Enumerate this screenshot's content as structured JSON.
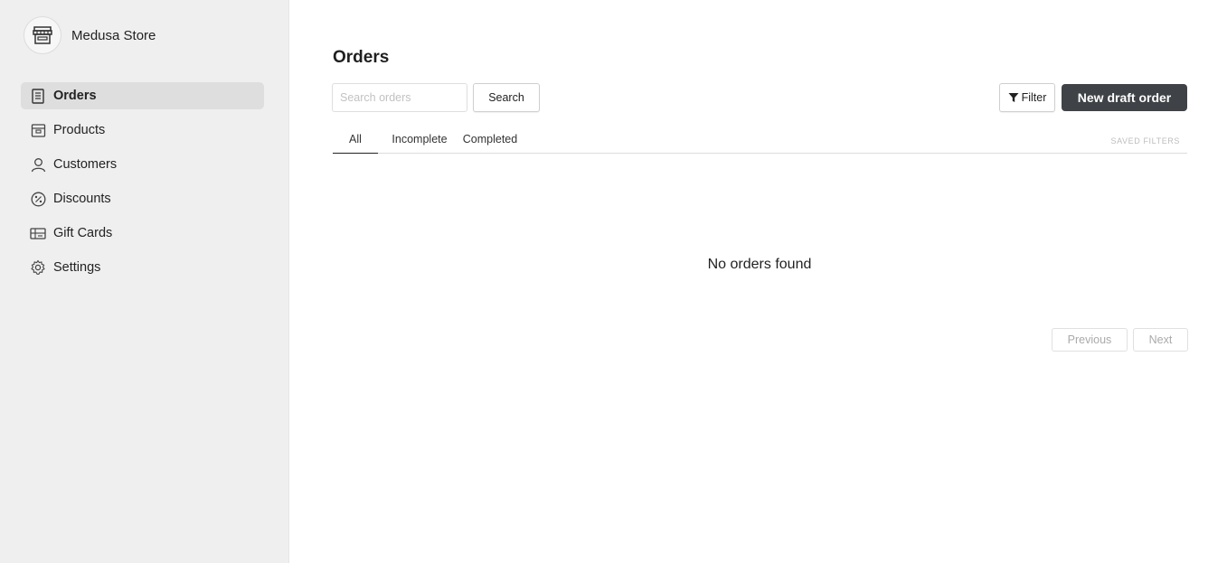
{
  "store": {
    "name": "Medusa Store",
    "logo_icon": "storefront-icon"
  },
  "nav": {
    "items": [
      {
        "label": "Orders",
        "icon": "receipt-icon",
        "active": true
      },
      {
        "label": "Products",
        "icon": "box-icon",
        "active": false
      },
      {
        "label": "Customers",
        "icon": "user-icon",
        "active": false
      },
      {
        "label": "Discounts",
        "icon": "percent-icon",
        "active": false
      },
      {
        "label": "Gift Cards",
        "icon": "gift-card-icon",
        "active": false
      },
      {
        "label": "Settings",
        "icon": "gear-icon",
        "active": false
      }
    ]
  },
  "page": {
    "title": "Orders"
  },
  "toolbar": {
    "search_placeholder": "Search orders",
    "search_value": "",
    "search_label": "Search",
    "filter_label": "Filter",
    "new_draft_label": "New draft order"
  },
  "tabs": {
    "items": [
      {
        "label": "All",
        "active": true
      },
      {
        "label": "Incomplete",
        "active": false
      },
      {
        "label": "Completed",
        "active": false
      }
    ],
    "saved_filters_label": "SAVED FILTERS"
  },
  "empty_state": {
    "message": "No orders found"
  },
  "pagination": {
    "previous_label": "Previous",
    "next_label": "Next"
  },
  "colors": {
    "primary_button": "#3f4246",
    "sidebar_bg": "#efefef",
    "active_nav_bg": "#dedede"
  }
}
